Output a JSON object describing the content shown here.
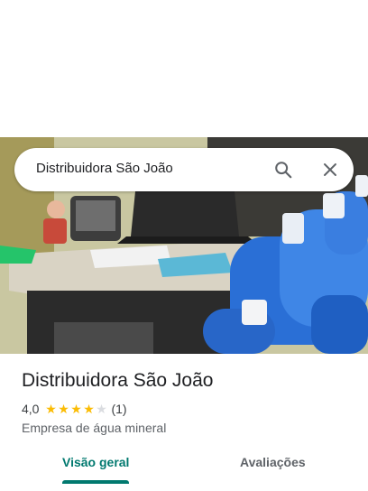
{
  "search": {
    "query": "Distribuidora São João"
  },
  "place": {
    "name": "Distribuidora São João",
    "rating": "4,0",
    "stars": 4,
    "max_stars": 5,
    "review_count": "(1)",
    "category": "Empresa de água mineral"
  },
  "tabs": [
    {
      "label": "Visão geral",
      "active": true
    },
    {
      "label": "Avaliações",
      "active": false
    }
  ],
  "icons": {
    "search": "search-icon",
    "close": "close-icon",
    "star": "star-icon"
  },
  "colors": {
    "accent": "#01796f",
    "star": "#fbbc04"
  }
}
